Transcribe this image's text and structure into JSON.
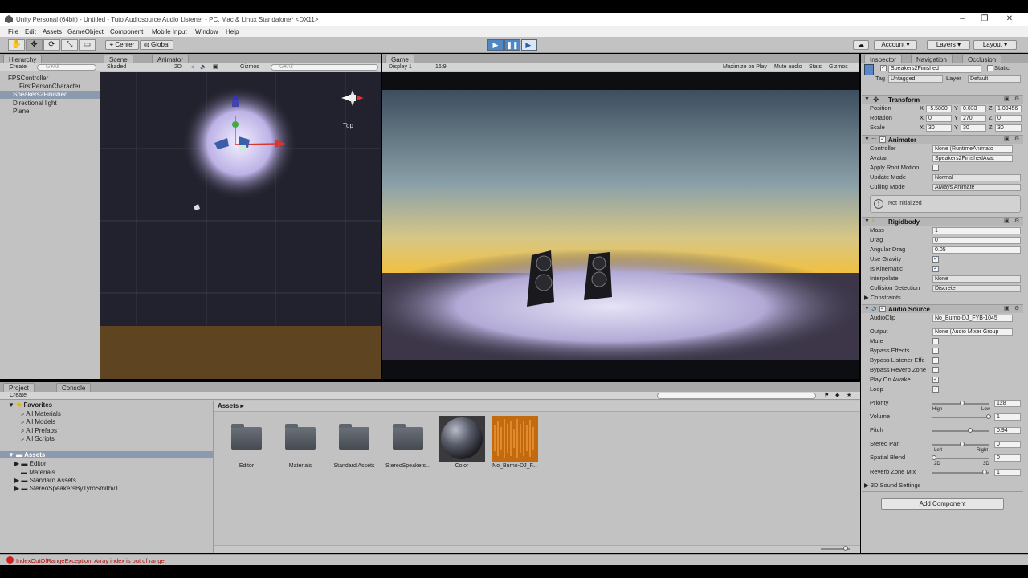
{
  "window": {
    "title": "Unity Personal (64bit) - Untitled - Tuto Audiosource Audio Listener - PC, Mac & Linux Standalone* <DX11>",
    "min": "–",
    "max": "❐",
    "close": "✕"
  },
  "menu": [
    "File",
    "Edit",
    "Assets",
    "GameObject",
    "Component",
    "Mobile Input",
    "Window",
    "Help"
  ],
  "toolbar": {
    "tools": [
      "✋",
      "✥",
      "⟳",
      "⤡",
      "▭"
    ],
    "center": "Center",
    "global": "Global",
    "play": "▶",
    "pause": "❚❚",
    "step": "▶|",
    "cloud": "☁",
    "account": "Account",
    "layers": "Layers",
    "layout": "Layout"
  },
  "hierarchy": {
    "tab": "Hierarchy",
    "create": "Create",
    "search": "G▾All",
    "items": [
      "FPSController",
      "FirstPersonCharacter",
      "Speakers2Finished",
      "Directional light",
      "Plane"
    ]
  },
  "scene": {
    "tab": "Scene",
    "tab2": "Animator",
    "shaded": "Shaded",
    "mode2d": "2D",
    "gizmos": "Gizmos",
    "search": "G▾All",
    "gizmo_label": "Top"
  },
  "game": {
    "tab": "Game",
    "display": "Display 1",
    "aspect": "16:9",
    "options": [
      "Maximize on Play",
      "Mute audio",
      "Stats",
      "Gizmos"
    ]
  },
  "inspector": {
    "tabs": [
      "Inspector",
      "Navigation",
      "Occlusion"
    ],
    "name": "Speakers2Finished",
    "static": "Static",
    "tag_label": "Tag",
    "tag": "Untagged",
    "layer_label": "Layer",
    "layer": "Default",
    "transform": {
      "title": "Transform",
      "rows": [
        {
          "label": "Position",
          "x": "-5.5800",
          "y": "0.033",
          "z": "1.09456"
        },
        {
          "label": "Rotation",
          "x": "0",
          "y": "270",
          "z": "0"
        },
        {
          "label": "Scale",
          "x": "30",
          "y": "30",
          "z": "30"
        }
      ]
    },
    "animator": {
      "title": "Animator",
      "controller_label": "Controller",
      "controller": "None (RuntimeAnimato",
      "avatar_label": "Avatar",
      "avatar": "Speakers2FinishedAvat",
      "root_label": "Apply Root Motion",
      "update_label": "Update Mode",
      "update": "Normal",
      "culling_label": "Culling Mode",
      "culling": "Always Animate",
      "info": "Not initialized"
    },
    "rigidbody": {
      "title": "Rigidbody",
      "mass_label": "Mass",
      "mass": "1",
      "drag_label": "Drag",
      "drag": "0",
      "adrag_label": "Angular Drag",
      "adrag": "0.05",
      "gravity_label": "Use Gravity",
      "kinematic_label": "Is Kinematic",
      "interp_label": "Interpolate",
      "interp": "None",
      "coll_label": "Collision Detection",
      "coll": "Discrete",
      "constraints": "Constraints"
    },
    "audio": {
      "title": "Audio Source",
      "clip_label": "AudioClip",
      "clip": "No_Burno-DJ_FYB-1045",
      "output_label": "Output",
      "output": "None (Audio Mixer Group",
      "mute": "Mute",
      "bypass_fx": "Bypass Effects",
      "bypass_listener": "Bypass Listener Effe",
      "bypass_reverb": "Bypass Reverb Zone",
      "play_awake": "Play On Awake",
      "loop": "Loop",
      "priority_label": "Priority",
      "priority": "128",
      "high": "High",
      "low": "Low",
      "volume_label": "Volume",
      "volume": "1",
      "pitch_label": "Pitch",
      "pitch": "0.94",
      "pan_label": "Stereo Pan",
      "pan": "0",
      "left": "Left",
      "right": "Right",
      "blend_label": "Spatial Blend",
      "blend": "0",
      "d2": "2D",
      "d3": "3D",
      "reverb_label": "Reverb Zone Mix",
      "reverb": "1",
      "settings3d": "3D Sound Settings"
    },
    "add_component": "Add Component"
  },
  "project": {
    "tabs": [
      "Project",
      "Console"
    ],
    "create": "Create",
    "favorites": "Favorites",
    "fav_items": [
      "All Materials",
      "All Models",
      "All Prefabs",
      "All Scripts"
    ],
    "assets": "Assets",
    "asset_tree": [
      "Editor",
      "Materials",
      "Standard Assets",
      "StereoSpeakersByTyroSmithv1"
    ],
    "breadcrumb": "Assets ▸",
    "grid": [
      {
        "label": "Editor",
        "kind": "folder"
      },
      {
        "label": "Materials",
        "kind": "folder"
      },
      {
        "label": "Standard Assets",
        "kind": "folder"
      },
      {
        "label": "StereoSpeakers...",
        "kind": "folder"
      },
      {
        "label": "Color",
        "kind": "material"
      },
      {
        "label": "No_Burno-DJ_F...",
        "kind": "audio"
      }
    ]
  },
  "status": {
    "error": "IndexOutOfRangeException: Array index is out of range."
  }
}
